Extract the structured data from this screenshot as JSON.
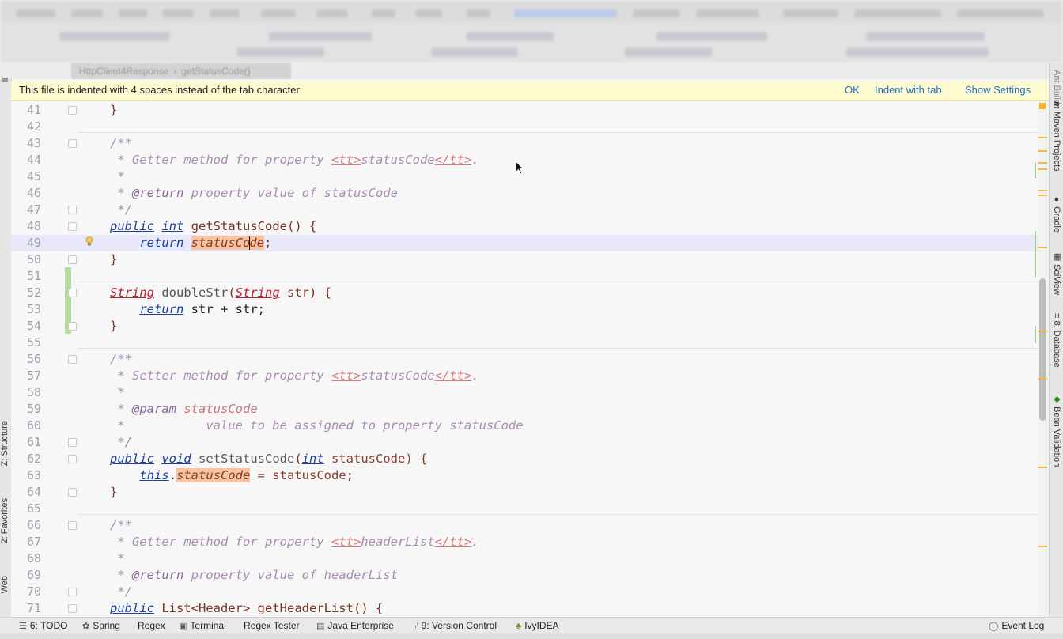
{
  "breadcrumb": {
    "class": "HttpClient4Response",
    "method": "getStatusCode()"
  },
  "notification": {
    "message": "This file is indented with 4 spaces instead of the tab character",
    "ok": "OK",
    "indent_with_tab": "Indent with tab",
    "show_settings": "Show Settings"
  },
  "left_tools": {
    "structure": "Z: Structure",
    "favorites": "2: Favorites",
    "web": "Web"
  },
  "right_tools": {
    "maven": "Maven Projects",
    "gradle": "Gradle",
    "sciview": "SciView",
    "database": "8: Database",
    "bean": "Bean Validation",
    "ant": "Ant Build"
  },
  "line_numbers": [
    "41",
    "42",
    "43",
    "44",
    "45",
    "46",
    "47",
    "48",
    "49",
    "50",
    "51",
    "52",
    "53",
    "54",
    "55",
    "56",
    "57",
    "58",
    "59",
    "60",
    "61",
    "62",
    "63",
    "64",
    "65",
    "66",
    "67",
    "68",
    "69",
    "70",
    "71"
  ],
  "code": {
    "l41": "}",
    "l43": "/**",
    "l44_a": " * Getter method for property ",
    "l44_tag1": "<tt>",
    "l44_name": "statusCode",
    "l44_tag2": "</tt>",
    "l44_end": ".",
    "l45": " *",
    "l46_a": " * ",
    "l46_tag": "@return",
    "l46_b": " property value of statusCode",
    "l47": " */",
    "l48_public": "public",
    "l48_int": "int",
    "l48_name": "getStatusCode",
    "l48_rest": "() {",
    "l49_return": "return",
    "l49_field_a": "statusCo",
    "l49_field_b": "de",
    "l49_end": ";",
    "l50": "}",
    "l52_type1": "String",
    "l52_name": "doubleStr",
    "l52_open": "(",
    "l52_type2": "String",
    "l52_param": " str",
    "l52_rest": ") {",
    "l53_return": "return",
    "l53_rest": " str + str;",
    "l54": "}",
    "l56": "/**",
    "l57_a": " * Setter method for property ",
    "l57_tag1": "<tt>",
    "l57_name": "statusCode",
    "l57_tag2": "</tt>",
    "l57_end": ".",
    "l58": " *",
    "l59_a": " * ",
    "l59_tag": "@param",
    "l59_sp": " ",
    "l59_param": "statusCode",
    "l60": " *           value to be assigned to property statusCode",
    "l61": " */",
    "l62_public": "public",
    "l62_void": "void",
    "l62_name": "setStatusCode",
    "l62_open": "(",
    "l62_int": "int",
    "l62_rest": " statusCode) {",
    "l63_this": "this",
    "l63_dot": ".",
    "l63_field": "statusCode",
    "l63_rest": " = statusCode;",
    "l64": "}",
    "l66": "/**",
    "l67_a": " * Getter method for property ",
    "l67_tag1": "<tt>",
    "l67_name": "headerList",
    "l67_tag2": "</tt>",
    "l67_end": ".",
    "l68": " *",
    "l69_a": " * ",
    "l69_tag": "@return",
    "l69_b": " property value of headerList",
    "l70": " */",
    "l71_public": "public",
    "l71_rest": " List<Header> ",
    "l71_name": "getHeaderList",
    "l71_end": "() {"
  },
  "status_bar": {
    "todo": "6: TODO",
    "spring": "Spring",
    "regex": "Regex",
    "terminal": "Terminal",
    "regex_tester": "Regex Tester",
    "java_enterprise": "Java Enterprise",
    "version_control": "9: Version Control",
    "ivyidea": "IvyIDEA",
    "event_log": "Event Log"
  },
  "colors": {
    "keyword": "#1a3ea3",
    "field_highlight": "#f7c3a0",
    "notification_bg": "#fdfbcf",
    "link": "#2470c2",
    "current_line": "#e8e8fa"
  }
}
